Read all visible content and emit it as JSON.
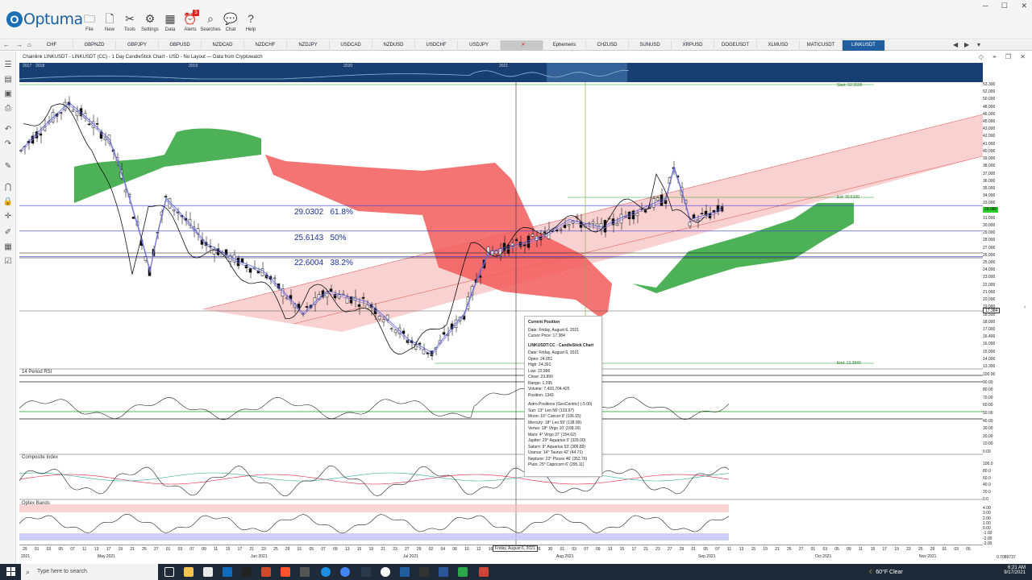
{
  "app": {
    "name": "Optuma",
    "brand_color": "#1b5fa0"
  },
  "toolbar": {
    "buttons": [
      {
        "label": "File",
        "icon": "folder-icon"
      },
      {
        "label": "New",
        "icon": "new-document-icon"
      },
      {
        "label": "Tools",
        "icon": "tools-icon"
      },
      {
        "label": "Settings",
        "icon": "settings-icon"
      },
      {
        "label": "Data",
        "icon": "data-icon"
      },
      {
        "label": "Alerts",
        "icon": "alarm-clock-icon",
        "badge": "3"
      },
      {
        "label": "Searches",
        "icon": "search-icon"
      },
      {
        "label": "Chat",
        "icon": "chat-icon"
      },
      {
        "label": "Help",
        "icon": "help-icon"
      }
    ]
  },
  "tabs": [
    "CHF",
    "GBPNZD",
    "GBPJPY",
    "GBPUSD",
    "NZDCAD",
    "NZDCHF",
    "NZDJPY",
    "USDCAD",
    "NZDUSD",
    "USDCHF",
    "USDJPY",
    "",
    "Ephemeris",
    "CHZUSD",
    "SUNUSD",
    "XRPUSD",
    "DOGEUSDT",
    "XLMUSD",
    "MATICUSDT",
    "LINKUSDT"
  ],
  "active_tab": "LINKUSDT",
  "chart_header": "Chainlink LINKUSDT - LINKUSDT (CC) - 1 Day CandleStick Chart - USD - No Layout — Data from Cryptowatch",
  "overview_years": [
    "2017",
    "2018",
    "2019",
    "2020",
    "2021"
  ],
  "fib_labels": [
    {
      "value": "29.0302",
      "pct": "61.8%"
    },
    {
      "value": "25.6143",
      "pct": "50%"
    },
    {
      "value": "22.6004",
      "pct": "38.2%"
    }
  ],
  "annotations": {
    "start": "Start: 52.9500",
    "ext": "Ext: 30.5100",
    "end": "End: 13.3840"
  },
  "price_axis": [
    "53.300",
    "52.000",
    "50.000",
    "48.000",
    "46.000",
    "45.000",
    "43.000",
    "42.000",
    "41.000",
    "40.000",
    "39.000",
    "38.000",
    "37.000",
    "36.000",
    "35.000",
    "34.000",
    "33.000",
    "32.000",
    "31.000",
    "30.000",
    "29.000",
    "28.000",
    "27.000",
    "26.000",
    "25.000",
    "24.000",
    "23.000",
    "22.000",
    "21.000",
    "20.000",
    "19.000",
    "18.500",
    "18.000",
    "17.000",
    "16.400",
    "16.000",
    "15.000",
    "14.000",
    "13.300"
  ],
  "price_tag_current": "29.080",
  "price_tag_cursor": "17.384",
  "panels": {
    "rsi": {
      "title": "14 Period RSI",
      "axis": [
        "100.00",
        "90.00",
        "80.00",
        "70.00",
        "60.00",
        "50.00",
        "40.00",
        "30.00",
        "20.00",
        "10.00",
        "0.00"
      ]
    },
    "composite": {
      "title": "Composite Index",
      "axis": [
        "100.0",
        "80.0",
        "60.0",
        "40.0",
        "20.0",
        "0.0"
      ]
    },
    "optex": {
      "title": "Optex Bands",
      "axis": [
        "4.00",
        "3.00",
        "2.00",
        "1.00",
        "0.00",
        "-1.00",
        "-2.00",
        "-3.00"
      ]
    }
  },
  "date_ticks": [
    "29",
    "01",
    "03",
    "05",
    "07",
    "11",
    "13",
    "17",
    "19",
    "21",
    "25",
    "27",
    "01",
    "03",
    "07",
    "09",
    "11",
    "15",
    "17",
    "21",
    "23",
    "25",
    "29",
    "01",
    "05",
    "07",
    "09",
    "13",
    "15",
    "19",
    "21",
    "23",
    "27",
    "29",
    "02",
    "04",
    "06",
    "10",
    "12",
    "16",
    "18",
    "20",
    "24",
    "26",
    "30",
    "01",
    "03",
    "07",
    "09",
    "13",
    "15",
    "17",
    "21",
    "23",
    "27",
    "29",
    "01",
    "05",
    "07",
    "11",
    "13",
    "15",
    "19",
    "21",
    "25",
    "27",
    "01",
    "03",
    "05",
    "09",
    "11",
    "15",
    "17",
    "19",
    "23",
    "25",
    "29",
    "01",
    "03",
    "05"
  ],
  "month_labels": [
    "2021",
    "May 2021",
    "Jun 2021",
    "Jul 2021",
    "Aug 2021",
    "Sep 2021",
    "Oct 2021",
    "Nov 2021"
  ],
  "cursor_date_label": "Friday, August 6, 2021",
  "bottom_right_value": "0.7089737",
  "tooltip": {
    "title": "Current Position",
    "date": "Date: Friday, August 6, 2021",
    "cursor_price": "Cursor Price: 17.384",
    "section": "LINKUSDT:CC - CandleStick Chart",
    "date2": "Date: Friday, August 6, 2021",
    "open": "Open: 24.051",
    "high": "High: 24.391",
    "low": "Low: 22.996",
    "close": "Close: 23.890",
    "range": "Range: 1.395",
    "volume": "Volume: 7,433,704.425",
    "position": "Position: 1343",
    "astro_title": "Astro Positions (GeoCentric) (-5.00)",
    "astro": [
      "Sun: 13° Leo 58' (133.97)",
      "Moon: 16° Cancer 9' (106.15)",
      "Mercury: 18° Leo 59' (138.99)",
      "Venus: 18° Virgo 10' (168.16)",
      "Mars: 4° Virgo 37' (154.62)",
      "Jupiter: 29° Aquarius 0' (329.00)",
      "Saturn: 9° Aquarius 53' (309.89)",
      "Uranus: 14° Taurus 42' (44.71)",
      "Neptune: 22° Pisces 46' (352.76)",
      "Pluto: 25° Capricorn 6' (295.11)"
    ]
  },
  "taskbar": {
    "search_placeholder": "Type here to search",
    "weather": "60°F  Clear",
    "time": "6:21 AM",
    "date": "9/17/2021"
  },
  "colors": {
    "cloud_red": "#f25b5b",
    "cloud_green": "#3aa845",
    "channel": "#f7b3b3",
    "fib_line": "#3b3bd1",
    "kijun": "#8e7bc9",
    "tenkan": "#4d5fe0",
    "lagging": "#111111"
  }
}
